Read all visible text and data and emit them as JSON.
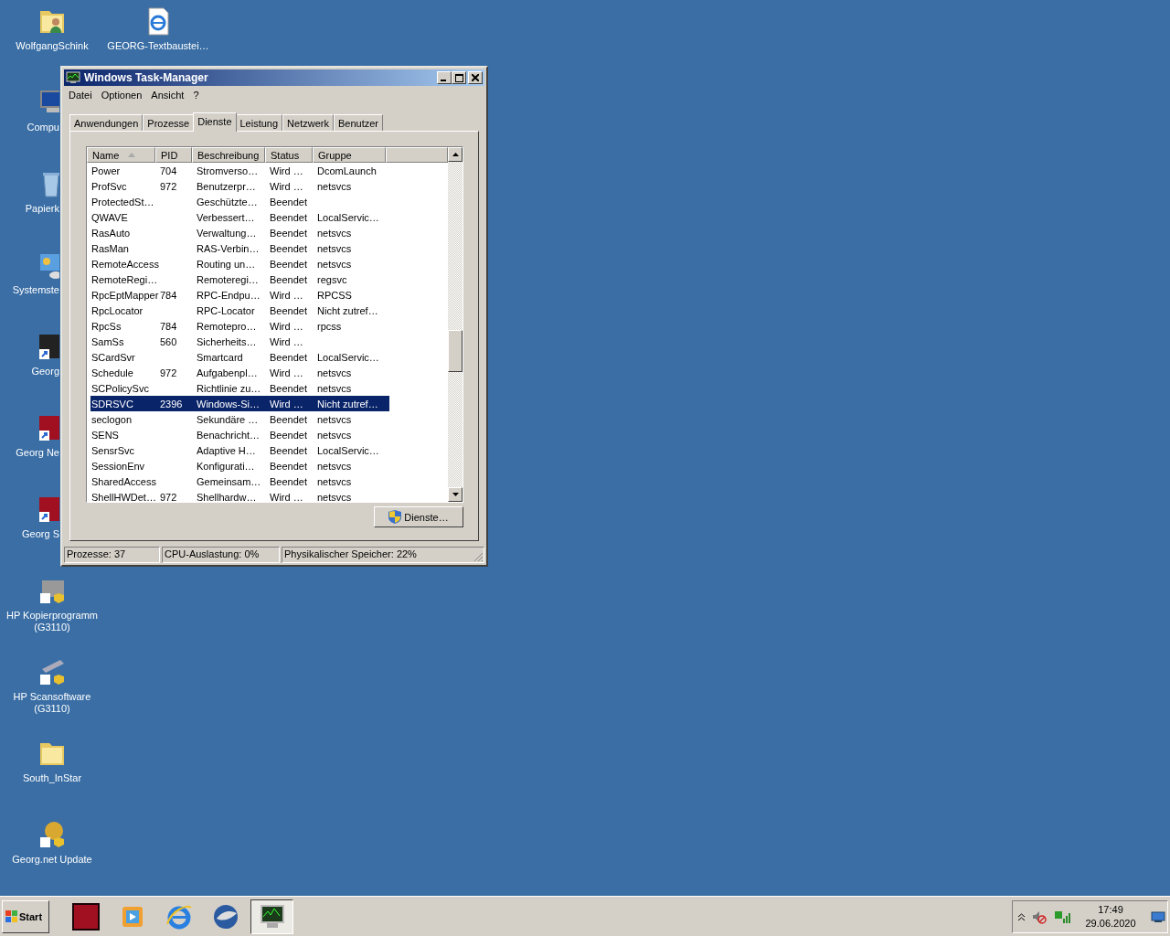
{
  "desktop": {
    "columns": [
      [
        {
          "label": "WolfgangSchink",
          "kind": "user-folder"
        },
        {
          "label": "Compu",
          "kind": "computer"
        },
        {
          "label": "Papierk",
          "kind": "bin"
        },
        {
          "label": "Systemste",
          "kind": "control"
        },
        {
          "label": "Georg",
          "kind": "ps"
        },
        {
          "label": "Georg Ne",
          "kind": "go"
        },
        {
          "label": "Georg S",
          "kind": "go"
        },
        {
          "label": "HP Kopierprogramm (G3110)",
          "kind": "printer"
        },
        {
          "label": "HP Scansoftware (G3110)",
          "kind": "scanner"
        },
        {
          "label": "South_InStar",
          "kind": "folder"
        },
        {
          "label": "Georg.net Update",
          "kind": "globe"
        }
      ],
      [
        {
          "label": "GEORG-Textbaustei…",
          "kind": "web"
        }
      ]
    ]
  },
  "window": {
    "title": "Windows Task-Manager",
    "menu": [
      "Datei",
      "Optionen",
      "Ansicht",
      "?"
    ],
    "tabs": [
      {
        "label": "Anwendungen",
        "selected": false
      },
      {
        "label": "Prozesse",
        "selected": false
      },
      {
        "label": "Dienste",
        "selected": true
      },
      {
        "label": "Leistung",
        "selected": false
      },
      {
        "label": "Netzwerk",
        "selected": false
      },
      {
        "label": "Benutzer",
        "selected": false
      }
    ],
    "table": {
      "columns": [
        {
          "label": "Name",
          "sorted": true
        },
        {
          "label": "PID",
          "sorted": false
        },
        {
          "label": "Beschreibung",
          "sorted": false
        },
        {
          "label": "Status",
          "sorted": false
        },
        {
          "label": "Gruppe",
          "sorted": false
        }
      ],
      "rows": [
        {
          "cells": [
            "Power",
            "704",
            "Stromverso…",
            "Wird …",
            "DcomLaunch"
          ],
          "selected": false
        },
        {
          "cells": [
            "ProfSvc",
            "972",
            "Benutzerpr…",
            "Wird …",
            "netsvcs"
          ],
          "selected": false
        },
        {
          "cells": [
            "ProtectedSt…",
            "",
            "Geschützte…",
            "Beendet",
            ""
          ],
          "selected": false
        },
        {
          "cells": [
            "QWAVE",
            "",
            "Verbessert…",
            "Beendet",
            "LocalServic…"
          ],
          "selected": false
        },
        {
          "cells": [
            "RasAuto",
            "",
            "Verwaltung…",
            "Beendet",
            "netsvcs"
          ],
          "selected": false
        },
        {
          "cells": [
            "RasMan",
            "",
            "RAS-Verbin…",
            "Beendet",
            "netsvcs"
          ],
          "selected": false
        },
        {
          "cells": [
            "RemoteAccess",
            "",
            "Routing un…",
            "Beendet",
            "netsvcs"
          ],
          "selected": false
        },
        {
          "cells": [
            "RemoteRegi…",
            "",
            "Remoteregi…",
            "Beendet",
            "regsvc"
          ],
          "selected": false
        },
        {
          "cells": [
            "RpcEptMapper",
            "784",
            "RPC-Endpu…",
            "Wird …",
            "RPCSS"
          ],
          "selected": false
        },
        {
          "cells": [
            "RpcLocator",
            "",
            "RPC-Locator",
            "Beendet",
            "Nicht zutref…"
          ],
          "selected": false
        },
        {
          "cells": [
            "RpcSs",
            "784",
            "Remotepro…",
            "Wird …",
            "rpcss"
          ],
          "selected": false
        },
        {
          "cells": [
            "SamSs",
            "560",
            "Sicherheits…",
            "Wird …",
            ""
          ],
          "selected": false
        },
        {
          "cells": [
            "SCardSvr",
            "",
            "Smartcard",
            "Beendet",
            "LocalServic…"
          ],
          "selected": false
        },
        {
          "cells": [
            "Schedule",
            "972",
            "Aufgabenpl…",
            "Wird …",
            "netsvcs"
          ],
          "selected": false
        },
        {
          "cells": [
            "SCPolicySvc",
            "",
            "Richtlinie zu…",
            "Beendet",
            "netsvcs"
          ],
          "selected": false
        },
        {
          "cells": [
            "SDRSVC",
            "2396",
            "Windows-Si…",
            "Wird …",
            "Nicht zutref…"
          ],
          "selected": true
        },
        {
          "cells": [
            "seclogon",
            "",
            "Sekundäre …",
            "Beendet",
            "netsvcs"
          ],
          "selected": false
        },
        {
          "cells": [
            "SENS",
            "",
            "Benachricht…",
            "Beendet",
            "netsvcs"
          ],
          "selected": false
        },
        {
          "cells": [
            "SensrSvc",
            "",
            "Adaptive H…",
            "Beendet",
            "LocalServic…"
          ],
          "selected": false
        },
        {
          "cells": [
            "SessionEnv",
            "",
            "Konfigurati…",
            "Beendet",
            "netsvcs"
          ],
          "selected": false
        },
        {
          "cells": [
            "SharedAccess",
            "",
            "Gemeinsam…",
            "Beendet",
            "netsvcs"
          ],
          "selected": false
        },
        {
          "cells": [
            "ShellHWDet…",
            "972",
            "Shellhardw…",
            "Wird …",
            "netsvcs"
          ],
          "selected": false
        }
      ]
    },
    "button": "Dienste…",
    "status_bar": [
      "Prozesse: 37",
      "CPU-Auslastung: 0%",
      "Physikalischer Speicher: 22%"
    ]
  },
  "taskbar": {
    "start": "Start",
    "apps": [
      {
        "kind": "go",
        "selected": false
      },
      {
        "kind": "media",
        "selected": false
      },
      {
        "kind": "ie",
        "selected": false
      },
      {
        "kind": "mail",
        "selected": false
      },
      {
        "kind": "taskmgr",
        "selected": true
      }
    ],
    "time": "17:49",
    "date": "29.06.2020"
  }
}
